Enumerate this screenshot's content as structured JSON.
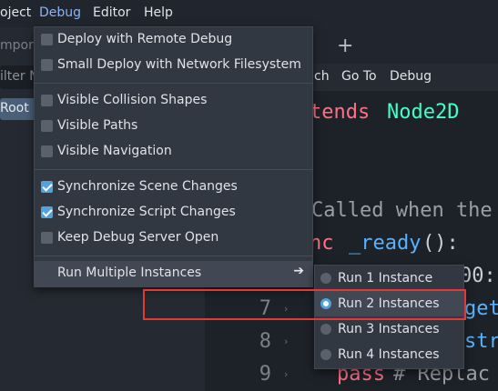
{
  "menubar": {
    "items": [
      {
        "label": "oject"
      },
      {
        "label": "Debug"
      },
      {
        "label": "Editor"
      },
      {
        "label": "Help"
      }
    ]
  },
  "left_dock": {
    "import_tab": "mport",
    "filter_placeholder": "ilter N",
    "root_node": "Root"
  },
  "editor_menu": {
    "items": [
      {
        "label": "ch"
      },
      {
        "label": "Go To"
      },
      {
        "label": "Debug"
      }
    ]
  },
  "code": {
    "line1_kw": "tends",
    "line1_type": "Node2D",
    "line2_comment": "Called when the",
    "line3_kw": "nc",
    "line3_fn": "_ready",
    "line3_rest": "():",
    "line4_partial": "00:",
    "line5_partial": "get",
    "line6_partial": "str",
    "line9_kw": "pass",
    "line9_comment": "# Replac",
    "line_numbers": [
      "7",
      "8",
      "9"
    ]
  },
  "debug_menu": {
    "items": [
      {
        "label": "Deploy with Remote Debug",
        "checked": false
      },
      {
        "label": "Small Deploy with Network Filesystem",
        "checked": false
      },
      {
        "label": "Visible Collision Shapes",
        "checked": false
      },
      {
        "label": "Visible Paths",
        "checked": false
      },
      {
        "label": "Visible Navigation",
        "checked": false
      },
      {
        "label": "Synchronize Scene Changes",
        "checked": true
      },
      {
        "label": "Synchronize Script Changes",
        "checked": true
      },
      {
        "label": "Keep Debug Server Open",
        "checked": false
      },
      {
        "label": "Run Multiple Instances"
      }
    ]
  },
  "submenu": {
    "items": [
      {
        "label": "Run 1 Instance",
        "selected": false
      },
      {
        "label": "Run 2 Instances",
        "selected": true
      },
      {
        "label": "Run 3 Instances",
        "selected": false
      },
      {
        "label": "Run 4 Instances",
        "selected": false
      }
    ]
  },
  "icons": {
    "tab_close": "×",
    "tab_add": "+",
    "submenu_arrow": "➔"
  },
  "colors": {
    "accent": "#4fa3e0",
    "highlight": "#e5383b",
    "menu_bg": "#323842"
  }
}
